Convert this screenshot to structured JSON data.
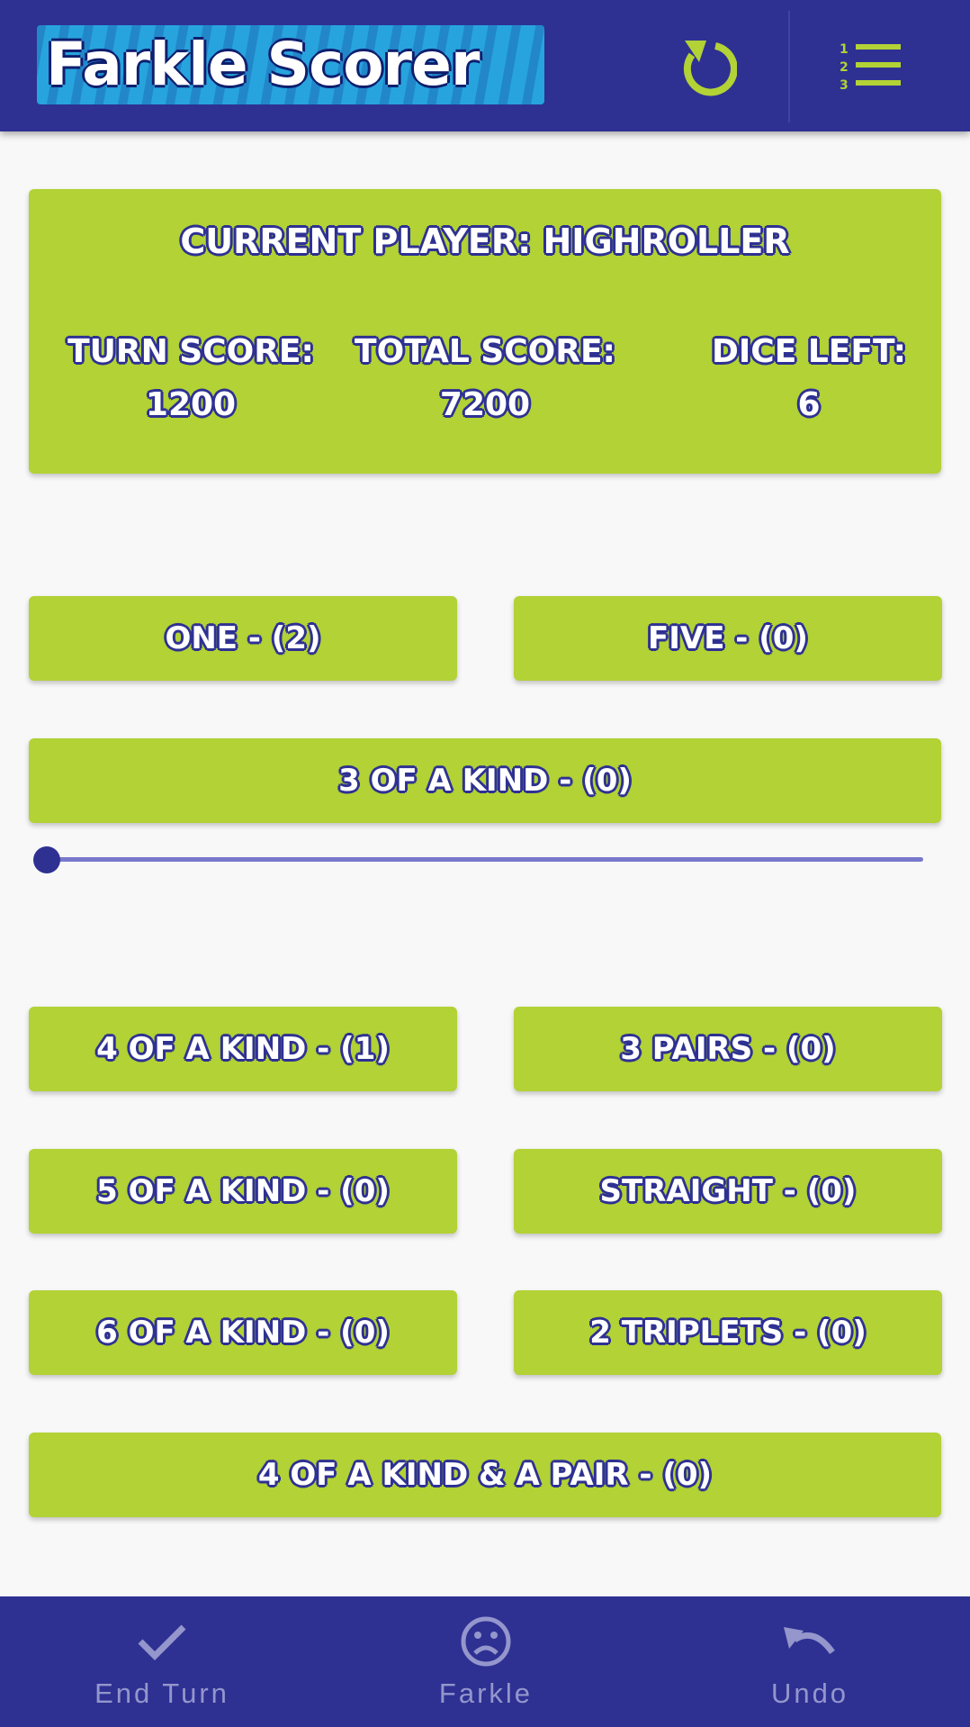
{
  "appbar": {
    "title": "Farkle Scorer",
    "refresh_icon": "refresh-icon",
    "ranking_icon": "ranked-list-icon",
    "icon_color": "#b2d235"
  },
  "status": {
    "current_player": "CURRENT PLAYER: HIGHROLLER",
    "turn_score_label": "TURN SCORE:",
    "turn_score_value": "1200",
    "total_score_label": "TOTAL SCORE:",
    "total_score_value": "7200",
    "dice_left_label": "DICE LEFT:",
    "dice_left_value": "6"
  },
  "buttons": {
    "one": "ONE - (2)",
    "five": "FIVE - (0)",
    "three_kind": "3 OF A KIND - (0)",
    "four_kind": "4 OF A KIND - (1)",
    "three_pairs": "3 PAIRS - (0)",
    "five_kind": "5 OF A KIND - (0)",
    "straight": "STRAIGHT - (0)",
    "six_kind": "6 OF A KIND - (0)",
    "two_triplets": "2 TRIPLETS - (0)",
    "four_kind_pair": "4 OF A KIND & A PAIR - (0)"
  },
  "slider": {
    "value_fraction": 0
  },
  "bottom_nav": {
    "end_turn": "End Turn",
    "farkle": "Farkle",
    "undo": "Undo",
    "icons": [
      "check-icon",
      "sad-face-icon",
      "undo-icon"
    ]
  },
  "colors": {
    "primary": "#2e3192",
    "accent": "#b2d235",
    "background": "#f8f8f8"
  }
}
